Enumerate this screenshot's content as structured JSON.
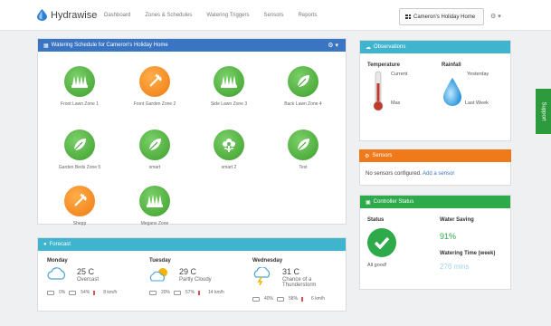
{
  "nav": {
    "brand": "Hydrawise",
    "links": [
      "Dashboard",
      "Zones & Schedules",
      "Watering Triggers",
      "Sensors",
      "Reports"
    ],
    "account": "Cameron's Holiday Home",
    "settings_caret": "▾"
  },
  "schedule": {
    "title": "Watering Schedule for Cameron's Holiday Home",
    "zones": [
      {
        "label": "Front Lawn Zone 1",
        "color": "green",
        "icon": "grass-icon"
      },
      {
        "label": "Front Garden Zone 2",
        "color": "orange",
        "icon": "rake-icon"
      },
      {
        "label": "Side Lawn Zone 3",
        "color": "green",
        "icon": "grass-icon"
      },
      {
        "label": "Back Lawn Zone 4",
        "color": "green",
        "icon": "leaf-icon"
      },
      {
        "label": "Garden Beds Zone 5",
        "color": "green",
        "icon": "leaf-icon"
      },
      {
        "label": "smart",
        "color": "green",
        "icon": "leaf-icon"
      },
      {
        "label": "smart 2",
        "color": "green",
        "icon": "flower-icon"
      },
      {
        "label": "Test",
        "color": "green",
        "icon": "leaf-icon"
      },
      {
        "label": "Shepp",
        "color": "orange",
        "icon": "rake-icon"
      },
      {
        "label": "Megans Zone",
        "color": "green",
        "icon": "grass-icon"
      }
    ]
  },
  "forecast": {
    "title": "Forecast",
    "days": [
      {
        "name": "Monday",
        "temp": "25 C",
        "cond": "Overcast",
        "rain": "0%",
        "humidity": "54%",
        "wind": "8 km/h"
      },
      {
        "name": "Tuesday",
        "temp": "29 C",
        "cond": "Partly Cloudy",
        "rain": "20%",
        "humidity": "57%",
        "wind": "14 km/h"
      },
      {
        "name": "Wednesday",
        "temp": "31 C",
        "cond": "Chance of a Thunderstorm",
        "rain": "40%",
        "humidity": "58%",
        "wind": "6 km/h"
      }
    ]
  },
  "observations": {
    "title": "Observations",
    "temperature": "Temperature",
    "current": "Current",
    "max": "Max",
    "rainfall": "Rainfall",
    "yesterday": "Yesterday",
    "last_week": "Last Week"
  },
  "sensors": {
    "title": "Sensors",
    "text": "No sensors configured.",
    "link": "Add a sensor"
  },
  "controller": {
    "title": "Controller Status",
    "status_label": "Status",
    "status_text": "All good!",
    "saving_label": "Water Saving",
    "saving_value": "91%",
    "time_label": "Watering Time (week)",
    "time_value": "276 mins"
  },
  "support": "Support",
  "colors": {
    "blue": "#3a75c4",
    "teal": "#3fb4cf",
    "orange": "#f07a1a",
    "green": "#2eaa4a"
  }
}
